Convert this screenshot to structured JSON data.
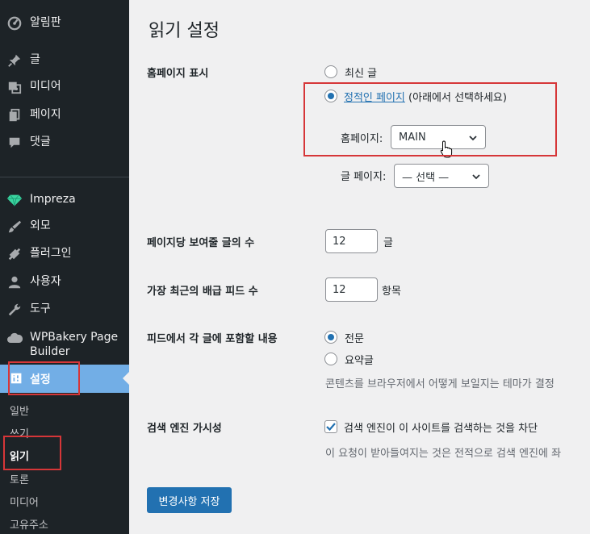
{
  "sidebar": {
    "items": [
      {
        "label": "알림판",
        "icon": "dashboard-icon"
      },
      {
        "label": "글",
        "icon": "pin-icon"
      },
      {
        "label": "미디어",
        "icon": "media-icon"
      },
      {
        "label": "페이지",
        "icon": "page-icon"
      },
      {
        "label": "댓글",
        "icon": "comment-icon"
      },
      {
        "label": "Impreza",
        "icon": "diamond-icon"
      },
      {
        "label": "외모",
        "icon": "brush-icon"
      },
      {
        "label": "플러그인",
        "icon": "plugin-icon"
      },
      {
        "label": "사용자",
        "icon": "user-icon"
      },
      {
        "label": "도구",
        "icon": "wrench-icon"
      },
      {
        "label": "WPBakery Page Builder",
        "label_line1": "WPBakery Page",
        "label_line2": "Builder",
        "icon": "cloud-icon"
      }
    ],
    "current": {
      "label": "설정",
      "icon": "settings-icon"
    },
    "submenu": [
      {
        "label": "일반"
      },
      {
        "label": "쓰기"
      },
      {
        "label": "읽기",
        "active": true
      },
      {
        "label": "토론"
      },
      {
        "label": "미디어"
      },
      {
        "label": "고유주소"
      }
    ]
  },
  "page": {
    "title": "읽기 설정",
    "homepage_display": {
      "label": "홈페이지 표시",
      "option_latest": "최신 글",
      "option_static_link": "정적인 페이지",
      "option_static_suffix": "(아래에서 선택하세요)",
      "homepage_label": "홈페이지:",
      "homepage_value": "MAIN",
      "posts_page_label": "글 페이지:",
      "posts_page_value": "— 선택 —"
    },
    "posts_per_page": {
      "label": "페이지당 보여줄 글의 수",
      "value": "12",
      "unit": "글"
    },
    "feed_items": {
      "label": "가장 최근의 배급 피드 수",
      "value": "12",
      "unit": "항목"
    },
    "feed_content": {
      "label": "피드에서 각 글에 포함할 내용",
      "option_full": "전문",
      "option_excerpt": "요약글",
      "description": "콘텐츠를 브라우저에서 어떻게 보일지는 테마가 결정"
    },
    "search_visibility": {
      "label": "검색 엔진 가시성",
      "checkbox_label": "검색 엔진이 이 사이트를 검색하는 것을 차단",
      "description": "이 요청이 받아들여지는 것은 전적으로 검색 엔진에 좌"
    },
    "save_button": "변경사항 저장"
  },
  "colors": {
    "accent": "#2271b1",
    "sidebar_bg": "#1d2327",
    "highlight": "#72aee6",
    "annotation": "#d63638"
  }
}
